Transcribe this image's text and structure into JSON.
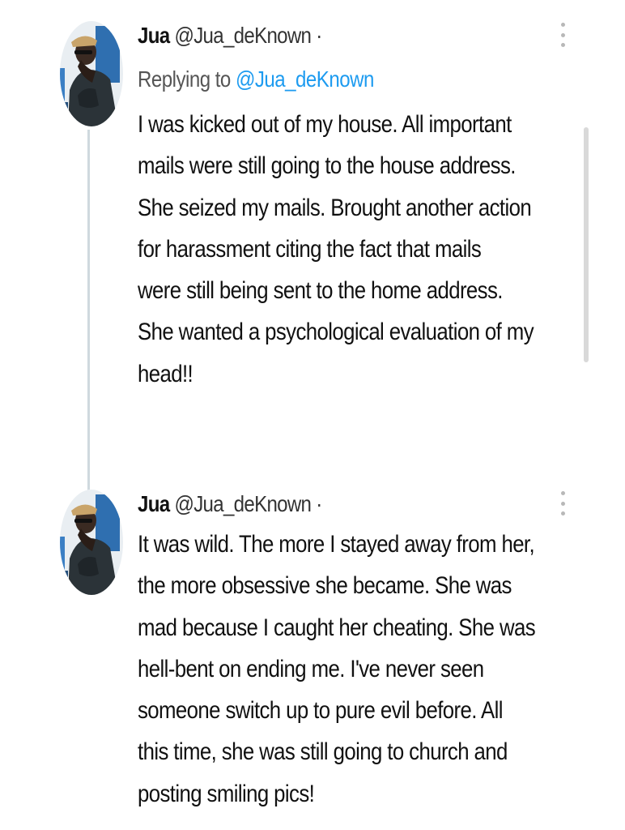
{
  "thread": {
    "tweets": [
      {
        "display_name": "Jua",
        "handle": "@Jua_deKnown",
        "separator": "·",
        "replying_label": "Replying to",
        "replying_handle": "@Jua_deKnown",
        "lines": [
          "I was kicked out of my house. All important",
          "mails were still going to the house address.",
          "She seized my mails. Brought another action",
          "for harassment citing the fact that mails",
          "were still being sent to the home address.",
          "She wanted a psychological evaluation of my",
          "head!!"
        ],
        "more_icon": "vertical-ellipsis-icon"
      },
      {
        "display_name": "Jua",
        "handle": "@Jua_deKnown",
        "separator": "·",
        "lines": [
          "It was wild. The more I stayed away from her,",
          "the more obsessive she became. She was",
          "mad because I caught her cheating. She was",
          "hell-bent on ending me. I've never seen",
          "someone switch up to pure evil before. All",
          "this time, she was still going to church and",
          "posting smiling pics!"
        ],
        "more_icon": "vertical-ellipsis-icon"
      }
    ]
  },
  "colors": {
    "link": "#1d9bf0",
    "text": "#111111",
    "thread_line": "#cfd9de"
  }
}
